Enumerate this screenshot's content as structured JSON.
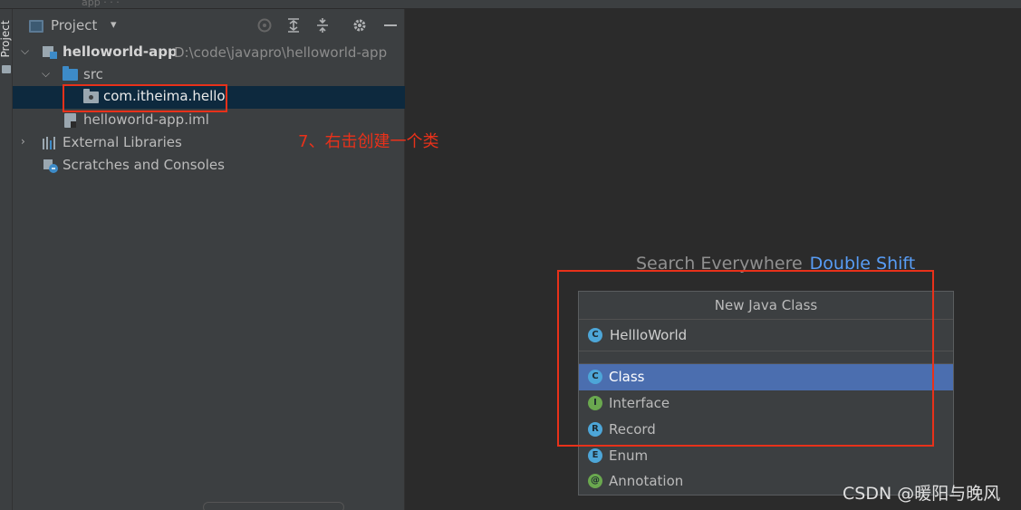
{
  "top_strip": {
    "ghost_text": "app   ·   ·   ·"
  },
  "tool_stripe": {
    "label": "Project"
  },
  "project_panel": {
    "title": "Project",
    "tree": [
      {
        "label": "helloworld-app",
        "path": "D:\\code\\javapro\\helloworld-app"
      },
      {
        "label": "src"
      },
      {
        "label": "com.itheima.hello"
      },
      {
        "label": "helloworld-app.iml"
      },
      {
        "label": "External Libraries"
      },
      {
        "label": "Scratches and Consoles"
      }
    ]
  },
  "annotation": {
    "text": "7、右击创建一个类"
  },
  "editor": {
    "search_hint": "Search Everywhere",
    "search_key": "Double Shift"
  },
  "new_class_popup": {
    "title": "New Java Class",
    "name_value": "HellloWorld",
    "name_badge": "C",
    "kinds": [
      {
        "label": "Class",
        "badge": "C",
        "color": "#4da6d8"
      },
      {
        "label": "Interface",
        "badge": "I",
        "color": "#6aa84f"
      },
      {
        "label": "Record",
        "badge": "R",
        "color": "#4da6d8"
      },
      {
        "label": "Enum",
        "badge": "E",
        "color": "#4da6d8"
      },
      {
        "label": "Annotation",
        "badge": "@",
        "color": "#6aa84f"
      }
    ],
    "selected_kind": "Class"
  },
  "watermark": {
    "text": "CSDN @暖阳与晚风"
  }
}
